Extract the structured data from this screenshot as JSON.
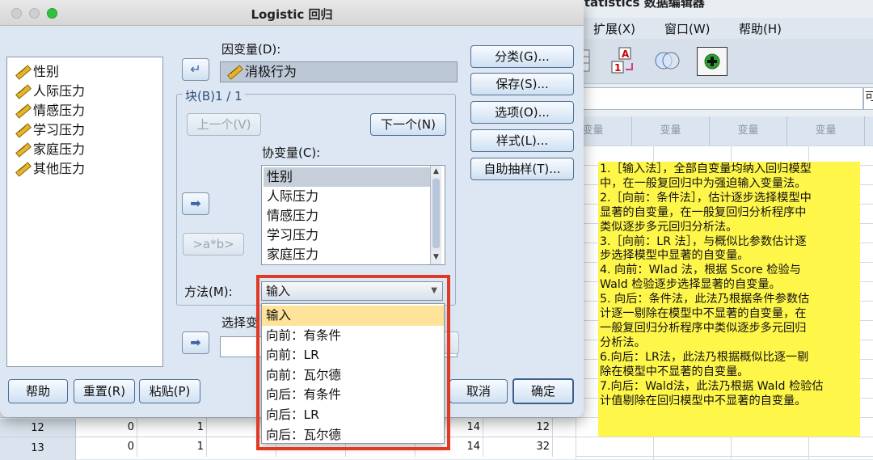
{
  "background_app": {
    "title": "Statistics 数据编辑器",
    "menu": [
      "扩展(X)",
      "窗口(W)",
      "帮助(H)"
    ],
    "formula_right": "可",
    "column_header": "变量",
    "rows": [
      {
        "num": "12",
        "cells": [
          "0",
          "1",
          "14",
          "12"
        ]
      },
      {
        "num": "13",
        "cells": [
          "0",
          "1",
          "14",
          "32"
        ]
      }
    ]
  },
  "annotation": {
    "lines": [
      "1.［输入法］，全部自变量均纳入回归模型",
      "中，在一般复回归中为强迫输入变量法。",
      "2.［向前：条件法］，估计逐步选择模型中",
      "显著的自变量，在一般复回归分析程序中",
      "类似逐步多元回归分析法。",
      "3.［向前：LR 法］，与概似比参数估计逐",
      "步选择模型中显著的自变量。",
      "4. 向前：Wlad 法，根据 Score 检验与",
      "Wald 检验逐步选择显著的自变量。",
      "5. 向后：条件法，此法乃根据条件参数估",
      "计逐一剔除在模型中不显著的自变量，在",
      "一般复回归分析程序中类似逐步多元回归",
      "分析法。",
      "6.向后：LR法，此法乃根据概似比逐一剔",
      "除在模型中不显著的自变量。",
      "7.向后：Wald法，此法乃根据 Wald 检验估",
      "计值剔除在回归模型中不显著的自变量。"
    ]
  },
  "dialog": {
    "title": "Logistic 回归",
    "variables": [
      "性别",
      "人际压力",
      "情感压力",
      "学习压力",
      "家庭压力",
      "其他压力"
    ],
    "dependent_label": "因变量(D):",
    "dependent_value": "消极行为",
    "block_label": "块(B)1 / 1",
    "prev_button": "上一个(V)",
    "next_button": "下一个(N)",
    "covariates_label": "协变量(C):",
    "covariates": [
      "性别",
      "人际压力",
      "情感压力",
      "学习压力",
      "家庭压力"
    ],
    "interaction_button": ">a*b>",
    "method_label": "方法(M):",
    "method_value": "输入",
    "method_options": [
      "输入",
      "向前：有条件",
      "向前：LR",
      "向前：瓦尔德",
      "向后：有条件",
      "向后：LR",
      "向后：瓦尔德"
    ],
    "selection_label": "选择变",
    "side_buttons": [
      "分类(G)...",
      "保存(S)...",
      "选项(O)...",
      "样式(L)...",
      "自助抽样(T)..."
    ],
    "bottom_buttons": {
      "help": "帮助",
      "reset": "重置(R)",
      "paste": "粘贴(P)",
      "cancel": "取消",
      "ok": "确定"
    }
  },
  "colors": {
    "highlight_yellow": "#fff64a",
    "frame_red": "#e03a25",
    "selection": "#ffe39a"
  }
}
